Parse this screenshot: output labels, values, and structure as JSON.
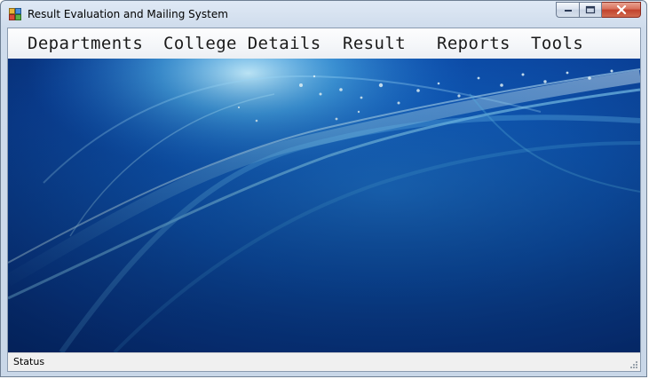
{
  "window": {
    "title": "Result Evaluation and Mailing System",
    "icon": "app-window-icon",
    "caption_buttons": [
      "minimize-icon",
      "maximize-icon",
      "close-icon"
    ]
  },
  "menu": {
    "items": [
      {
        "label": "Departments"
      },
      {
        "label": "College Details"
      },
      {
        "label": "Result"
      },
      {
        "label": "Reports"
      },
      {
        "label": "Tools"
      }
    ]
  },
  "status": {
    "label": "Status"
  },
  "colors": {
    "background_blue": "#0f5bbd",
    "light_streak": "#7fd4ff",
    "close_red": "#c2412c"
  }
}
